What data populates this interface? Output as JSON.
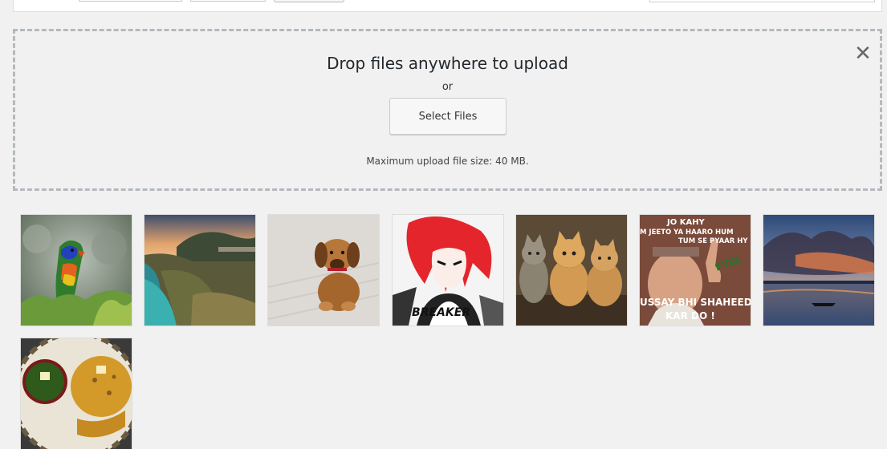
{
  "uploader": {
    "title": "Drop files anywhere to upload",
    "or_text": "or",
    "select_button": "Select Files",
    "max_size": "Maximum upload file size: 40 MB."
  },
  "attachments": [
    {
      "icon": "parrot-image"
    },
    {
      "icon": "coastline-image"
    },
    {
      "icon": "puppy-image"
    },
    {
      "icon": "anime-girl-image"
    },
    {
      "icon": "kittens-image"
    },
    {
      "icon": "meme-image"
    },
    {
      "icon": "sunset-lake-image"
    },
    {
      "icon": "food-plate-image"
    }
  ],
  "meme": {
    "line1": "JO KAHY",
    "line2": "M JEETO YA HAARO HUM",
    "line3": "TUM SE PYAAR HY",
    "line4": "USSAY BHI SHAHEED",
    "line5": "KAR DO !",
    "badge": "FYSL"
  },
  "anime": {
    "logo": "BREAKER"
  }
}
